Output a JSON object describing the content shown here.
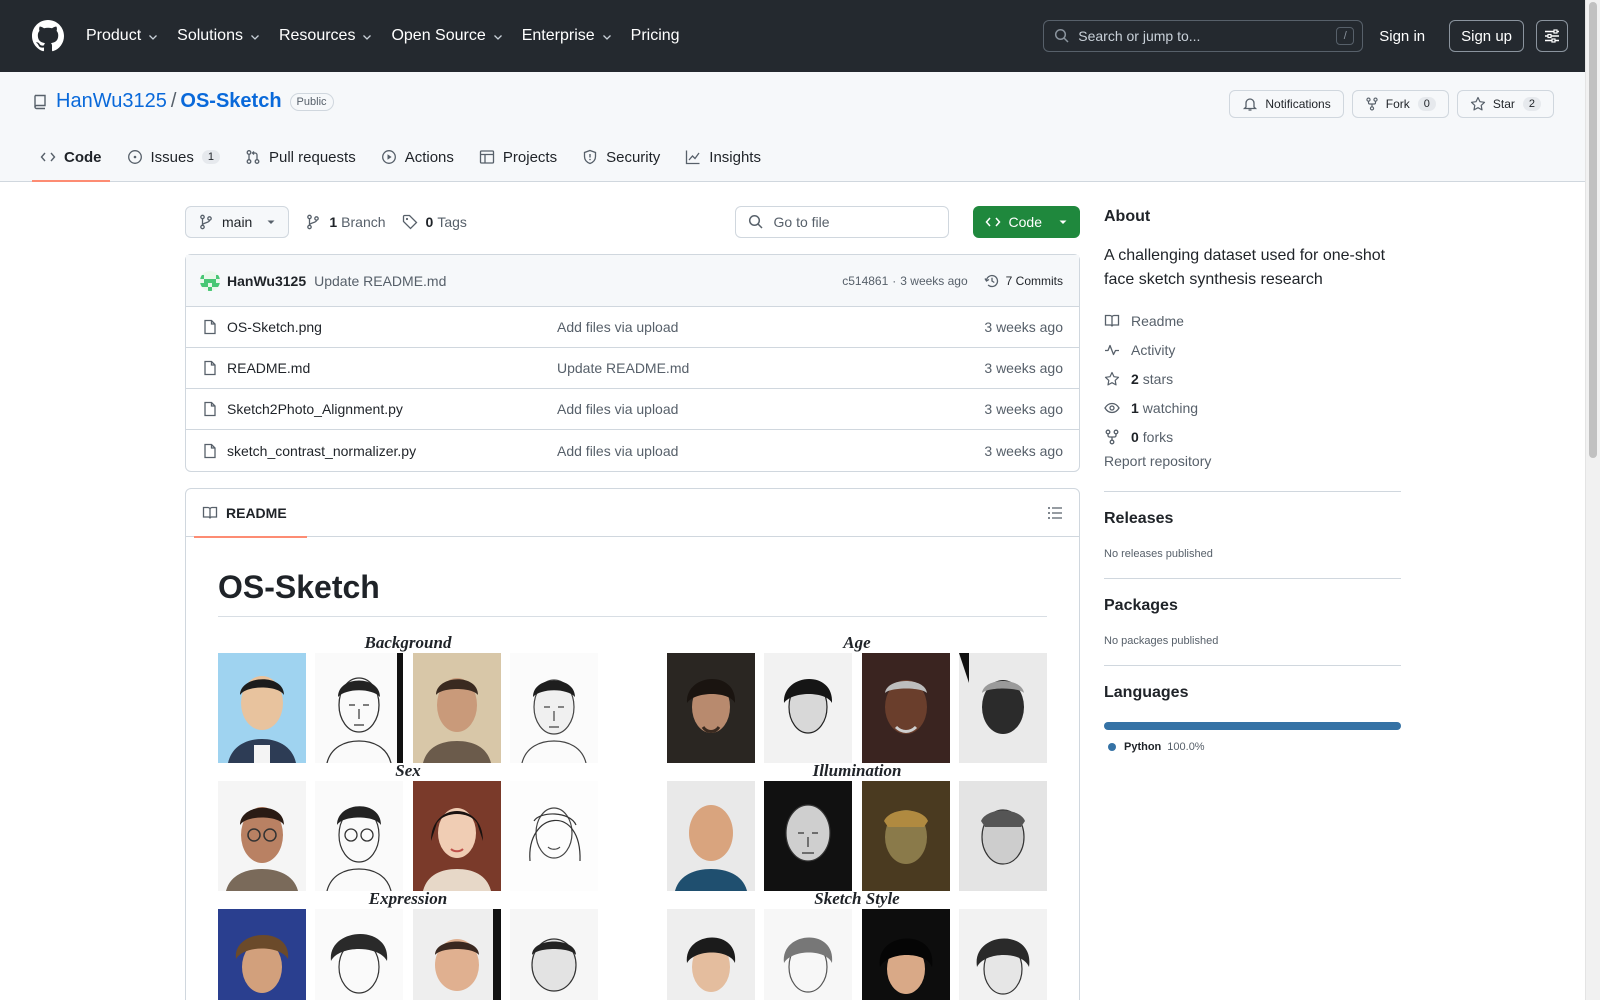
{
  "topnav": {
    "items": [
      "Product",
      "Solutions",
      "Resources",
      "Open Source",
      "Enterprise",
      "Pricing"
    ],
    "search_placeholder": "Search or jump to...",
    "search_key": "/",
    "sign_in": "Sign in",
    "sign_up": "Sign up"
  },
  "repo": {
    "owner": "HanWu3125",
    "separator": "/",
    "name": "OS-Sketch",
    "visibility": "Public",
    "notifications": "Notifications",
    "fork_label": "Fork",
    "fork_count": "0",
    "star_label": "Star",
    "star_count": "2"
  },
  "tabs": [
    {
      "label": "Code",
      "icon": "code-icon"
    },
    {
      "label": "Issues",
      "icon": "issue-icon",
      "count": "1"
    },
    {
      "label": "Pull requests",
      "icon": "pull-request-icon"
    },
    {
      "label": "Actions",
      "icon": "play-icon"
    },
    {
      "label": "Projects",
      "icon": "table-icon"
    },
    {
      "label": "Security",
      "icon": "shield-icon"
    },
    {
      "label": "Insights",
      "icon": "graph-icon"
    }
  ],
  "toolbar": {
    "branch": "main",
    "branch_count": "1",
    "branch_label": "Branch",
    "tag_count": "0",
    "tag_label": "Tags",
    "goto_placeholder": "Go to file",
    "code_button": "Code"
  },
  "commit": {
    "author": "HanWu3125",
    "message": "Update README.md",
    "sha": "c514861",
    "dot": "·",
    "age": "3 weeks ago",
    "commits": "7 Commits"
  },
  "files": [
    {
      "name": "OS-Sketch.png",
      "message": "Add files via upload",
      "date": "3 weeks ago"
    },
    {
      "name": "README.md",
      "message": "Update README.md",
      "date": "3 weeks ago"
    },
    {
      "name": "Sketch2Photo_Alignment.py",
      "message": "Add files via upload",
      "date": "3 weeks ago"
    },
    {
      "name": "sketch_contrast_normalizer.py",
      "message": "Add files via upload",
      "date": "3 weeks ago"
    }
  ],
  "readme": {
    "tab_label": "README",
    "title": "OS-Sketch",
    "groups": {
      "background": "Background",
      "age": "Age",
      "sex": "Sex",
      "illumination": "Illumination",
      "expression": "Expression",
      "sketch_style": "Sketch Style"
    }
  },
  "about": {
    "heading": "About",
    "description": "A challenging dataset used for one-shot face sketch synthesis research",
    "readme": "Readme",
    "activity": "Activity",
    "stars_count": "2",
    "stars_label": "stars",
    "watching_count": "1",
    "watching_label": "watching",
    "forks_count": "0",
    "forks_label": "forks",
    "report": "Report repository"
  },
  "releases": {
    "heading": "Releases",
    "empty": "No releases published"
  },
  "packages": {
    "heading": "Packages",
    "empty": "No packages published"
  },
  "languages": {
    "heading": "Languages",
    "name": "Python",
    "percent": "100.0%",
    "color": "#3572a5",
    "share": 1.0
  }
}
